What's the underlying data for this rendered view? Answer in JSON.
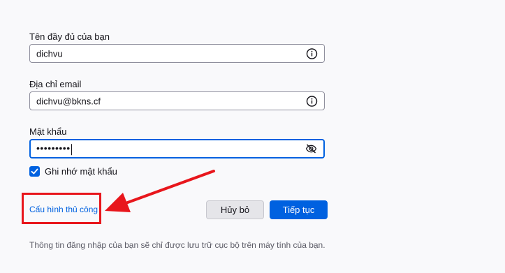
{
  "form": {
    "name_label": "Tên đầy đủ của bạn",
    "name_value": "dichvu",
    "email_label": "Địa chỉ email",
    "email_value": "dichvu@bkns.cf",
    "password_label": "Mật khẩu",
    "password_value": "•••••••••",
    "remember_label": "Ghi nhớ mật khẩu",
    "remember_checked": true
  },
  "actions": {
    "manual_config_label": "Cấu hình thủ công",
    "cancel_label": "Hủy bỏ",
    "continue_label": "Tiếp tục"
  },
  "footnote": "Thông tin đăng nhập của bạn sẽ chỉ được lưu trữ cục bộ trên máy tính của bạn.",
  "icons": {
    "name_info": "info-icon",
    "email_info": "info-icon",
    "password_toggle": "eye-slash-icon",
    "checkbox_mark": "checkmark-icon"
  },
  "colors": {
    "accent": "#0061e0",
    "annotation": "#e8161c",
    "background": "#f9f9fb"
  }
}
